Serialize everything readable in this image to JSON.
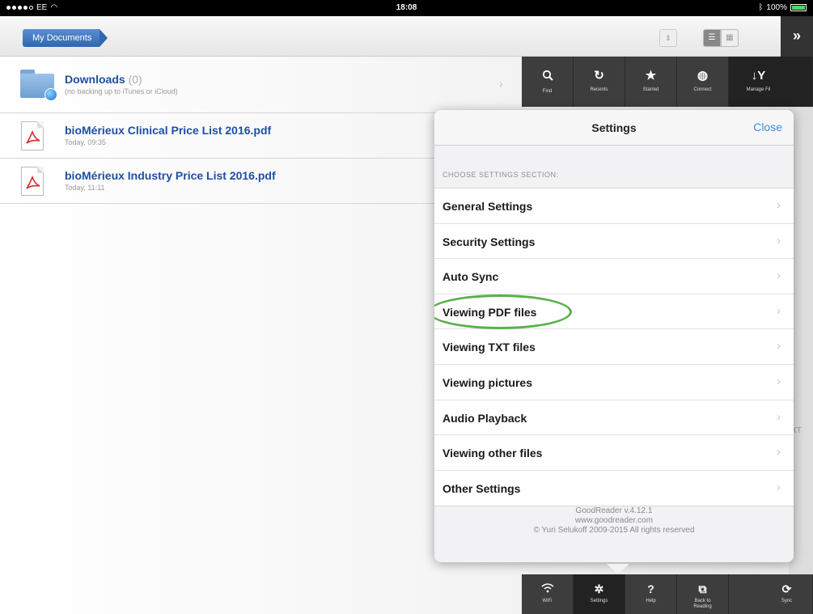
{
  "status_bar": {
    "carrier": "EE",
    "time": "18:08",
    "battery_percent": "100%",
    "battery_level": 1.0
  },
  "topnav": {
    "breadcrumb": "My Documents",
    "sort_glyph": "⇕",
    "list_view_glyph": "☰",
    "grid_view_glyph": "▦",
    "expand_glyph": "»"
  },
  "files": [
    {
      "type": "folder",
      "name": "Downloads",
      "count": "(0)",
      "subtitle": "(no backing up to iTunes or iCloud)"
    },
    {
      "type": "pdf",
      "name": "bioMérieux Clinical Price List 2016.pdf",
      "subtitle": "Today, 09:35"
    },
    {
      "type": "pdf",
      "name": "bioMérieux Industry Price List 2016.pdf",
      "subtitle": "Today, 11:11"
    }
  ],
  "toolbar": {
    "find": {
      "glyph": "🔍",
      "label": "Find"
    },
    "recents": {
      "glyph": "↻",
      "label": "Recents"
    },
    "starred": {
      "glyph": "★",
      "label": "Starred"
    },
    "connect": {
      "glyph": "◍",
      "label": "Connect"
    },
    "manage": {
      "glyph": "↓Y",
      "label": "Manage Fil"
    }
  },
  "bottom_toolbar": {
    "wifi": {
      "glyph": "⌔",
      "label": "WiFi"
    },
    "settings": {
      "glyph": "✲",
      "label": "Settings"
    },
    "help": {
      "glyph": "?",
      "label": "Help"
    },
    "back": {
      "glyph": "⧉",
      "label": "Back to Reading"
    },
    "sync": {
      "glyph": "⟳",
      "label": "Sync"
    }
  },
  "side_peek": "XT",
  "settings": {
    "title": "Settings",
    "close_label": "Close",
    "section_header": "CHOOSE SETTINGS SECTION:",
    "items": [
      "General Settings",
      "Security Settings",
      "Auto Sync",
      "Viewing PDF files",
      "Viewing TXT files",
      "Viewing pictures",
      "Audio Playback",
      "Viewing other files",
      "Other Settings"
    ],
    "chevron": "›",
    "footer": {
      "version": "GoodReader v.4.12.1",
      "website": "www.goodreader.com",
      "copyright": "© Yuri Selukoff 2009-2015 All rights reserved"
    }
  },
  "colors": {
    "accent": "#3a8ee6",
    "breadcrumb": "#2f66b0",
    "file_name": "#1e4fa3",
    "highlight_ring": "#58b14a",
    "toolbar_bg": "#3d3d3d"
  }
}
